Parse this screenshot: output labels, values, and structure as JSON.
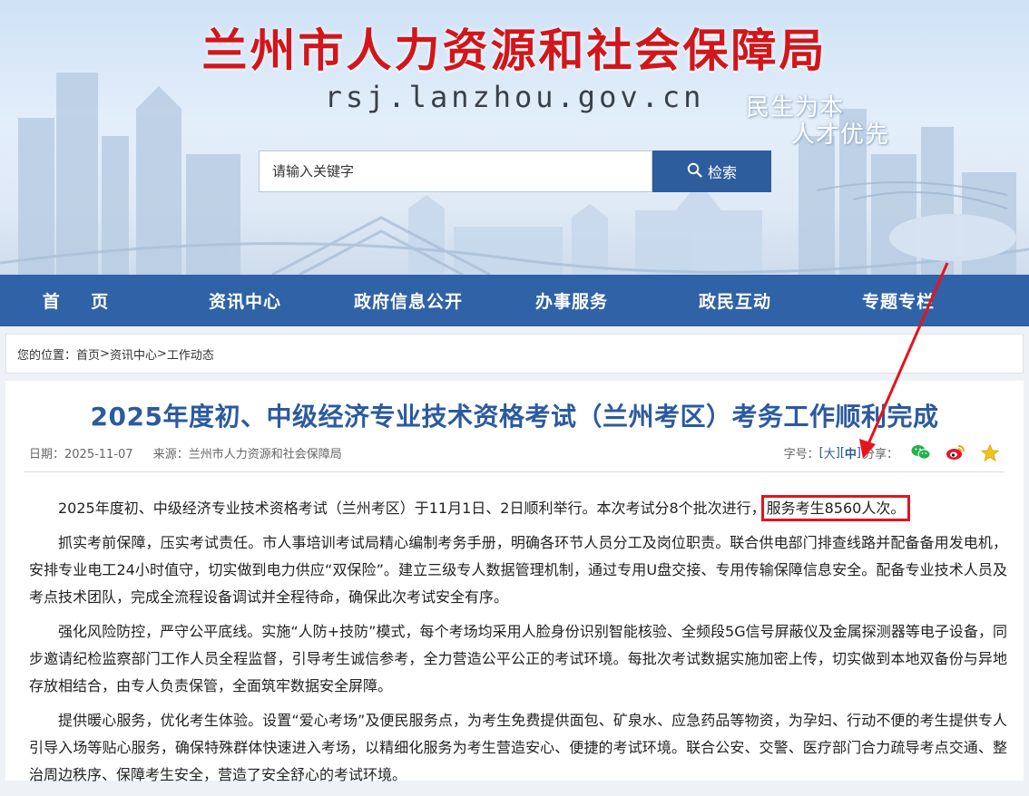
{
  "header": {
    "site_title": "兰州市人力资源和社会保障局",
    "site_url": "rsj.lanzhou.gov.cn",
    "slogan_line1": "民生为本",
    "slogan_line2": "人才优先",
    "search_placeholder": "请输入关键字",
    "search_button": "检索"
  },
  "nav": [
    {
      "label": "首页",
      "display": "首 页"
    },
    {
      "label": "资讯中心"
    },
    {
      "label": "政府信息公开"
    },
    {
      "label": "办事服务"
    },
    {
      "label": "政民互动"
    },
    {
      "label": "专题专栏"
    }
  ],
  "breadcrumb": {
    "prefix": "您的位置：",
    "items": [
      "首页",
      "资讯中心",
      "工作动态"
    ],
    "separator": ">"
  },
  "article": {
    "title": "2025年度初、中级经济专业技术资格考试（兰州考区）考务工作顺利完成",
    "date": "日期：2025-11-07",
    "source": "来源：兰州市人力资源和社会保障局",
    "font_size_label": "字号：",
    "font_large": "大",
    "font_medium": "中",
    "share_label": "分享：",
    "p1_before": "2025年度初、中级经济专业技术资格考试（兰州考区）于11月1日、2日顺利举行。本次考试分8个批次进行，",
    "p1_highlight": "服务考生8560人次。",
    "p2": "抓实考前保障，压实考试责任。市人事培训考试局精心编制考务手册，明确各环节人员分工及岗位职责。联合供电部门排查线路并配备备用发电机，安排专业电工24小时值守，切实做到电力供应“双保险”。建立三级专人数据管理机制，通过专用U盘交接、专用传输保障信息安全。配备专业技术人员及考点技术团队，完成全流程设备调试并全程待命，确保此次考试安全有序。",
    "p3": "强化风险防控，严守公平底线。实施“人防+技防”模式，每个考场均采用人脸身份识别智能核验、全频段5G信号屏蔽仪及金属探测器等电子设备，同步邀请纪检监察部门工作人员全程监督，引导考生诚信参考，全力营造公平公正的考试环境。每批次考试数据实施加密上传，切实做到本地双备份与异地存放相结合，由专人负责保管，全面筑牢数据安全屏障。",
    "p4": "提供暖心服务，优化考生体验。设置“爱心考场”及便民服务点，为考生免费提供面包、矿泉水、应急药品等物资，为孕妇、行动不便的考生提供专人引导入场等贴心服务，确保特殊群体快速进入考场，以精细化服务为考生营造安心、便捷的考试环境。联合公安、交警、医疗部门合力疏导考点交通、整治周边秩序、保障考生安全，营造了安全舒心的考试环境。"
  },
  "colors": {
    "title_red": "#d2161b",
    "nav_blue": "#2f62a6",
    "article_title_blue": "#2b5aa0",
    "highlight_red": "#e4141b"
  },
  "icons": [
    "search-icon",
    "wechat-icon",
    "weibo-icon",
    "favorite-star-icon"
  ]
}
